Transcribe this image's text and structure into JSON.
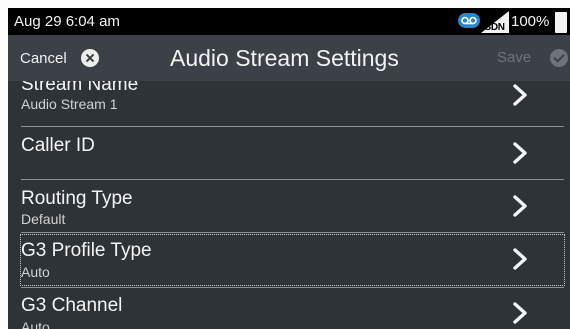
{
  "status_bar": {
    "time": "Aug 29 6:04 am",
    "network_label": "ISDN",
    "battery_text": "100%",
    "battery_level_percent": 100,
    "voicemail_icon": "voicemail-icon",
    "accent_color": "#2c86c9"
  },
  "action_bar": {
    "cancel_label": "Cancel",
    "title": "Audio Stream Settings",
    "save_label": "Save",
    "save_enabled": false
  },
  "settings": [
    {
      "title": "Stream Name",
      "value": "Audio Stream 1"
    },
    {
      "title": "Caller ID",
      "value": ""
    },
    {
      "title": "Routing Type",
      "value": "Default"
    },
    {
      "title": "G3 Profile Type",
      "value": "Auto",
      "focused": true
    },
    {
      "title": "G3 Channel",
      "value": "Auto"
    }
  ]
}
